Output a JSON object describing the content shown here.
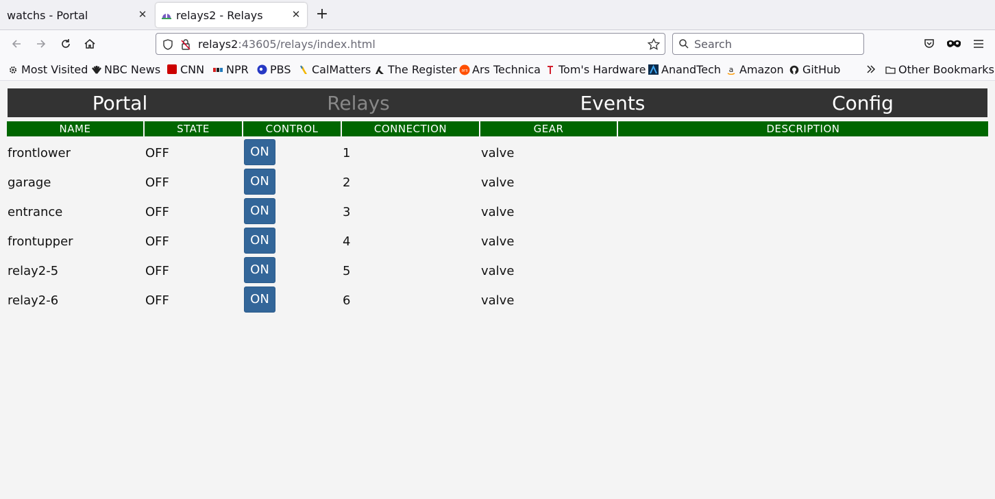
{
  "browser": {
    "tabs": [
      {
        "title": "watchs - Portal",
        "active": false
      },
      {
        "title": "relays2 - Relays",
        "active": true
      }
    ],
    "url": {
      "host": "relays2",
      "rest": ":43605/relays/index.html"
    },
    "search_placeholder": "Search",
    "bookmarks": [
      {
        "label": "Most Visited",
        "icon": "gear-icon"
      },
      {
        "label": "NBC News",
        "icon": "nbc-icon"
      },
      {
        "label": "CNN",
        "icon": "cnn-icon"
      },
      {
        "label": "NPR",
        "icon": "npr-icon"
      },
      {
        "label": "PBS",
        "icon": "pbs-icon"
      },
      {
        "label": "CalMatters",
        "icon": "calmatters-icon"
      },
      {
        "label": "The Register",
        "icon": "register-icon"
      },
      {
        "label": "Ars Technica",
        "icon": "ars-icon"
      },
      {
        "label": "Tom's Hardware",
        "icon": "toms-icon"
      },
      {
        "label": "AnandTech",
        "icon": "anandtech-icon"
      },
      {
        "label": "Amazon",
        "icon": "amazon-icon"
      },
      {
        "label": "GitHub",
        "icon": "github-icon"
      }
    ],
    "other_bookmarks": "Other Bookmarks"
  },
  "nav": {
    "portal": "Portal",
    "relays": "Relays",
    "events": "Events",
    "config": "Config"
  },
  "table": {
    "headers": [
      "NAME",
      "STATE",
      "CONTROL",
      "CONNECTION",
      "GEAR",
      "DESCRIPTION"
    ],
    "rows": [
      {
        "name": "frontlower",
        "state": "OFF",
        "control": "ON",
        "connection": "1",
        "gear": "valve",
        "description": ""
      },
      {
        "name": "garage",
        "state": "OFF",
        "control": "ON",
        "connection": "2",
        "gear": "valve",
        "description": ""
      },
      {
        "name": "entrance",
        "state": "OFF",
        "control": "ON",
        "connection": "3",
        "gear": "valve",
        "description": ""
      },
      {
        "name": "frontupper",
        "state": "OFF",
        "control": "ON",
        "connection": "4",
        "gear": "valve",
        "description": ""
      },
      {
        "name": "relay2-5",
        "state": "OFF",
        "control": "ON",
        "connection": "5",
        "gear": "valve",
        "description": ""
      },
      {
        "name": "relay2-6",
        "state": "OFF",
        "control": "ON",
        "connection": "6",
        "gear": "valve",
        "description": ""
      }
    ]
  },
  "colors": {
    "nav_bg": "#333333",
    "header_bg": "#006600",
    "button_bg": "#336699"
  }
}
